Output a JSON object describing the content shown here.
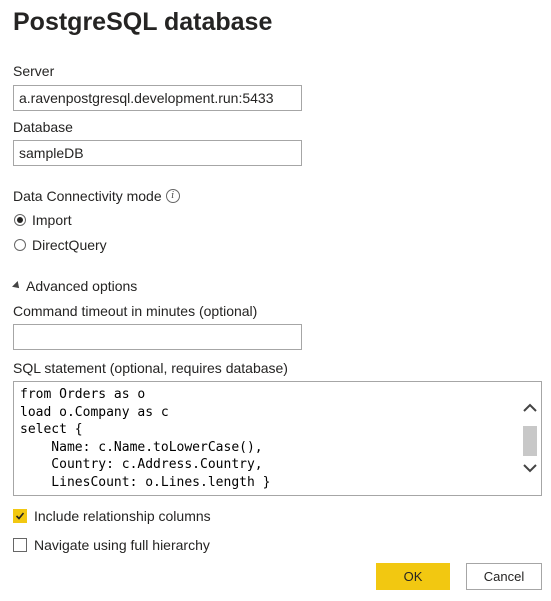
{
  "dialog": {
    "title": "PostgreSQL database"
  },
  "server": {
    "label": "Server",
    "value": "a.ravenpostgresql.development.run:5433"
  },
  "database": {
    "label": "Database",
    "value": "sampleDB"
  },
  "connectivity": {
    "label": "Data Connectivity mode",
    "options": [
      {
        "label": "Import",
        "selected": true
      },
      {
        "label": "DirectQuery",
        "selected": false
      }
    ]
  },
  "advanced": {
    "toggle_label": "Advanced options",
    "timeout": {
      "label": "Command timeout in minutes (optional)",
      "value": ""
    },
    "sql": {
      "label": "SQL statement (optional, requires database)",
      "value": "from Orders as o\nload o.Company as c\nselect {\n    Name: c.Name.toLowerCase(),\n    Country: c.Address.Country,\n    LinesCount: o.Lines.length }"
    },
    "include_relationships": {
      "label": "Include relationship columns",
      "checked": true
    },
    "full_hierarchy": {
      "label": "Navigate using full hierarchy",
      "checked": false
    }
  },
  "buttons": {
    "ok": "OK",
    "cancel": "Cancel"
  },
  "colors": {
    "accent": "#f2c811",
    "border": "#a6a6a6",
    "text": "#252423"
  }
}
